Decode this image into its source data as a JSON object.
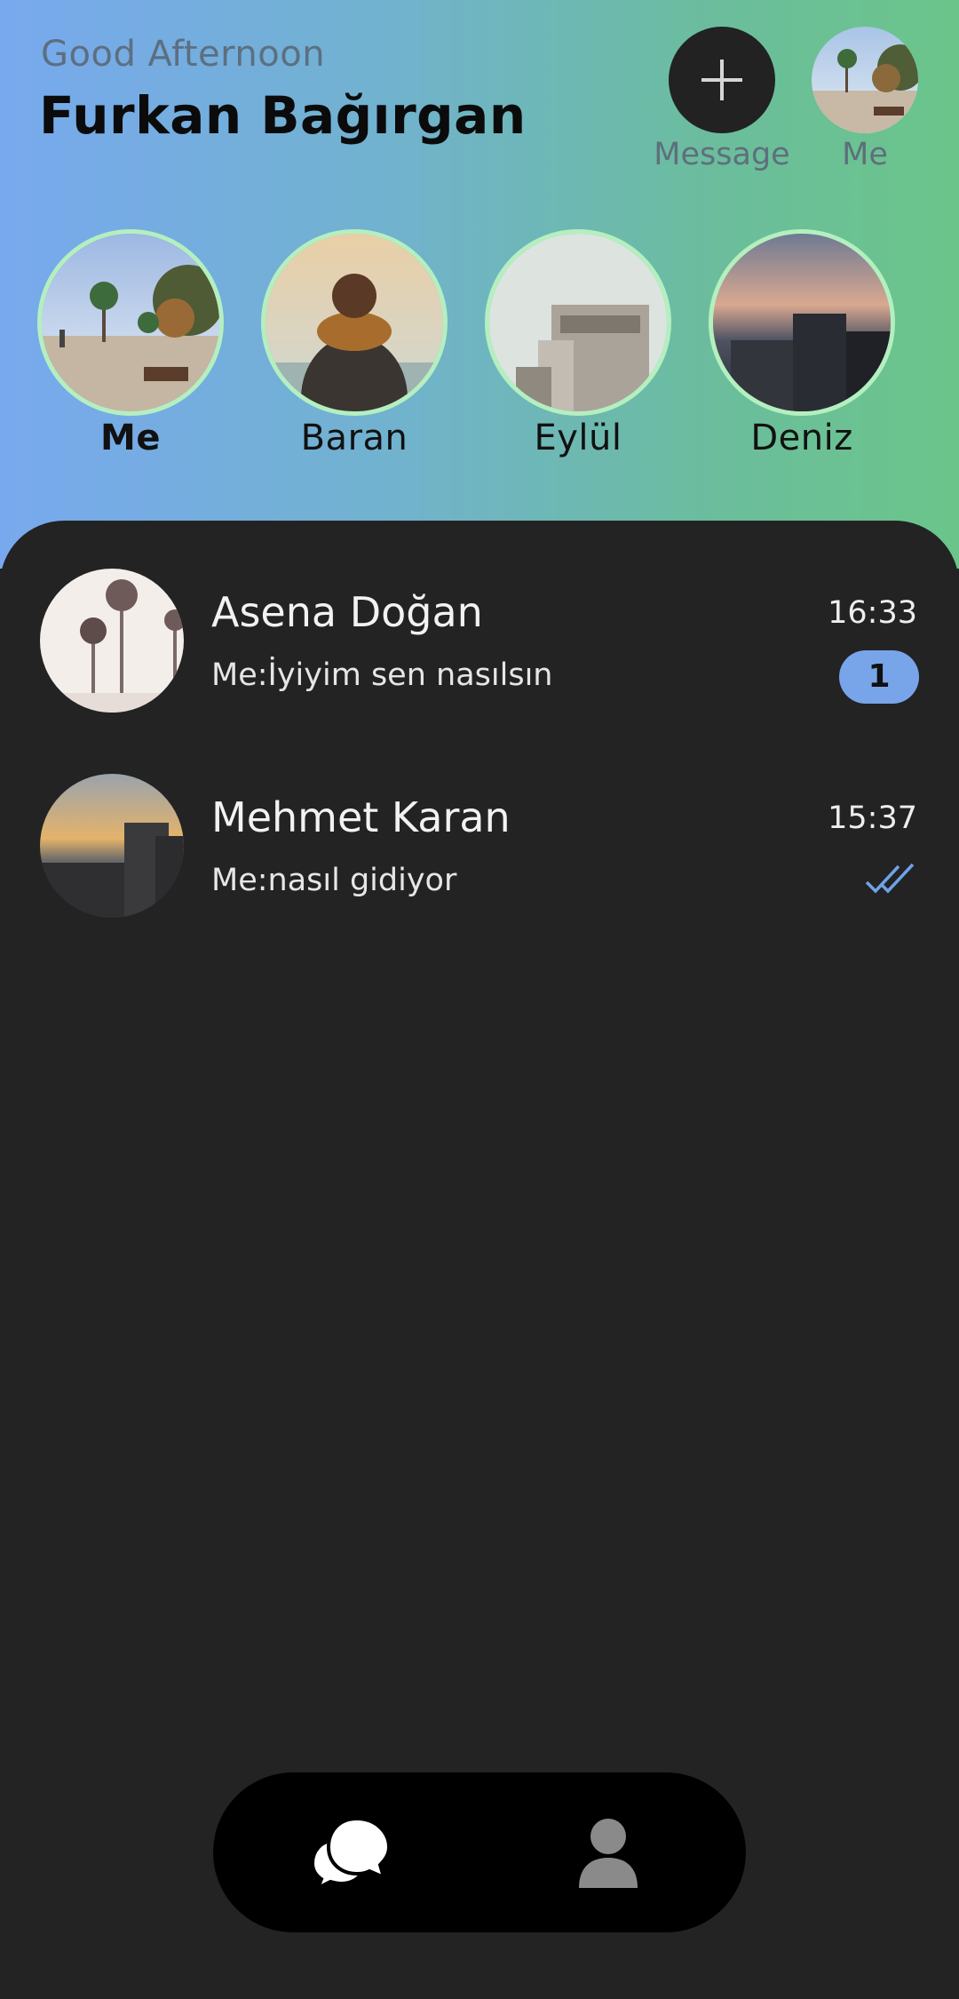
{
  "header": {
    "greeting": "Good Afternoon",
    "user_name": "Furkan Bağırgan",
    "new_message_label": "Message",
    "profile_label": "Me"
  },
  "stories": [
    {
      "name": "Me",
      "bold": true
    },
    {
      "name": "Baran",
      "bold": false
    },
    {
      "name": "Eylül",
      "bold": false
    },
    {
      "name": "Deniz",
      "bold": false
    }
  ],
  "chats": [
    {
      "name": "Asena Doğan",
      "preview": "Me:İyiyim sen nasılsın",
      "time": "16:33",
      "unread": "1"
    },
    {
      "name": "Mehmet Karan",
      "preview": "Me:nasıl gidiyor",
      "time": "15:37",
      "status": "read"
    }
  ],
  "nav": {
    "items": [
      {
        "icon": "chat-bubbles-icon",
        "active": true
      },
      {
        "icon": "person-icon",
        "active": false
      }
    ]
  },
  "colors": {
    "gradient_start": "#78a9ee",
    "gradient_end": "#6bc58a",
    "story_ring": "#b4efbf",
    "badge": "#78a5ea",
    "background": "#232323"
  }
}
